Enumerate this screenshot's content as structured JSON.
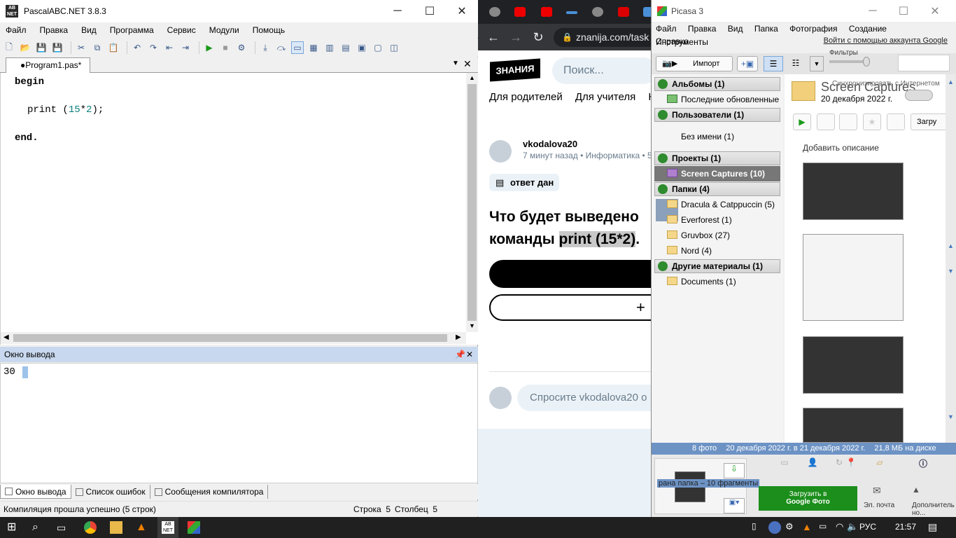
{
  "pascal": {
    "title": "PascalABC.NET 3.8.3",
    "menu": [
      "Файл",
      "Правка",
      "Вид",
      "Программа",
      "Сервис",
      "Модули",
      "Помощь"
    ],
    "tab": "●Program1.pas*",
    "code": {
      "l1": "begin",
      "l2a": "print (",
      "l2b": "15",
      "l2c": "*",
      "l2d": "2",
      "l2e": ");",
      "l3": "end."
    },
    "output_title": "Окно вывода",
    "output_text": "30",
    "bottom_tabs": [
      "Окно вывода",
      "Список ошибок",
      "Сообщения компилятора"
    ],
    "status": "Компиляция прошла успешно (5 строк)",
    "row_label": "Строка  5",
    "col_label": "Столбец  5"
  },
  "chrome": {
    "url": "znanija.com/task",
    "logo": "ЗНАНИЯ",
    "search_placeholder": "Поиск...",
    "nav": [
      "Для родителей",
      "Для учителя",
      "К"
    ],
    "user": "vkodalova20",
    "meta": "7 минут назад • Информатика • 5",
    "badge": "ответ дан",
    "question_l1": "Что будет выведено",
    "question_l2a": "команды ",
    "question_l2b": "print (15*2)",
    "question_l2c": ".",
    "ask": "Спросите vkodalova20 о"
  },
  "picasa": {
    "title": "Picasa 3",
    "menu": [
      "Файл",
      "Правка",
      "Вид",
      "Папка",
      "Фотография",
      "Создание",
      "Инструменты",
      "Справка"
    ],
    "signin": "Войти с помощью аккаунта Google",
    "import": "Импорт",
    "filters": "Фильтры",
    "sync": "Синхронизировать с Интернетом",
    "sections": {
      "albums": "Альбомы (1)",
      "recent": "Последние обновленные",
      "people": "Пользователи (1)",
      "noname": "Без имени (1)",
      "projects": "Проекты (1)",
      "captures": "Screen Captures (10)",
      "folders": "Папки (4)",
      "f1": "Dracula & Catppuccin (5)",
      "f2": "Everforest (1)",
      "f3": "Gruvbox (27)",
      "f4": "Nord (4)",
      "other": "Другие материалы (1)",
      "docs": "Documents (1)"
    },
    "album_title": "Screen Captures",
    "album_date": "20 декабря 2022 г.",
    "upload_short": "Загру",
    "add_desc": "Добавить описание",
    "info_count": "8 фото",
    "info_range": "20 декабря 2022 г. в 21 декабря 2022 г.",
    "info_size": "21,8 МБ на диске",
    "tray_label": "рана папка – 10 фрагменты",
    "upload_btn_l1": "Загрузить в",
    "upload_btn_l2": "Google Фото",
    "mail": "Эл. почта",
    "more": "Дополнитель но..."
  },
  "taskbar": {
    "lang": "РУС",
    "time": "21:57"
  }
}
